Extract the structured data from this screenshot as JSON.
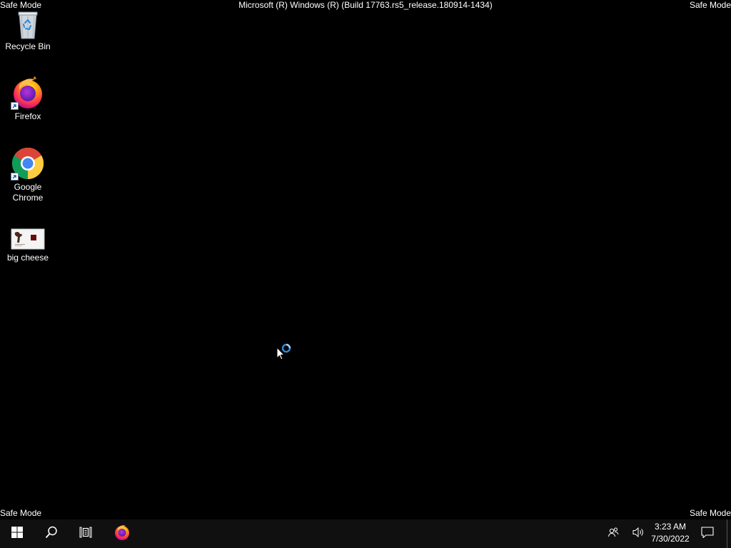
{
  "overlay": {
    "safe_mode_label": "Safe Mode",
    "build_string": "Microsoft (R) Windows (R) (Build 17763.rs5_release.180914-1434)"
  },
  "desktop_icons": [
    {
      "label": "Recycle Bin",
      "icon": "recycle-bin-icon"
    },
    {
      "label": "Firefox",
      "icon": "firefox-icon"
    },
    {
      "label": "Google\nChrome",
      "icon": "chrome-icon"
    },
    {
      "label": "big cheese",
      "icon": "image-thumbnail-icon"
    }
  ],
  "taskbar": {
    "start_icon": "windows-logo-icon",
    "search_icon": "search-icon",
    "task_view_icon": "task-view-icon",
    "pinned": [
      {
        "name": "Firefox",
        "icon": "firefox-icon"
      }
    ],
    "tray": {
      "people_icon": "people-icon",
      "volume_icon": "volume-icon",
      "time": "3:23 AM",
      "date": "7/30/2022",
      "notifications_icon": "action-center-icon"
    }
  },
  "colors": {
    "background": "#000000",
    "taskbar": "#101010",
    "accent": "#2b88d8"
  }
}
